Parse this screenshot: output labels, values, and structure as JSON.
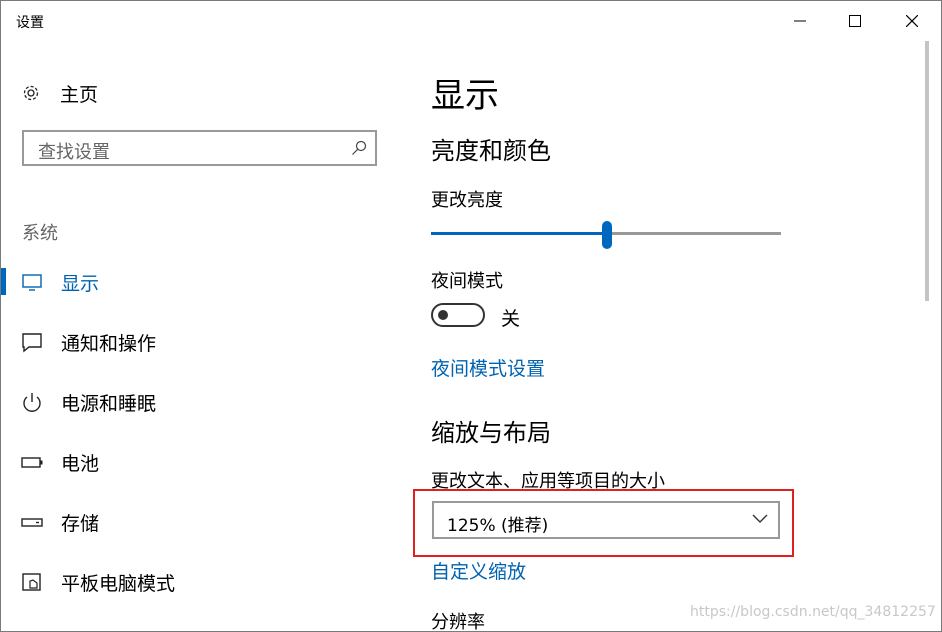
{
  "window": {
    "title": "设置"
  },
  "sidebar": {
    "home_label": "主页",
    "search_placeholder": "查找设置",
    "section_label": "系统",
    "items": [
      {
        "label": "显示",
        "icon": "monitor-icon",
        "active": true
      },
      {
        "label": "通知和操作",
        "icon": "notification-icon",
        "active": false
      },
      {
        "label": "电源和睡眠",
        "icon": "power-icon",
        "active": false
      },
      {
        "label": "电池",
        "icon": "battery-icon",
        "active": false
      },
      {
        "label": "存储",
        "icon": "storage-icon",
        "active": false
      },
      {
        "label": "平板电脑模式",
        "icon": "tablet-mode-icon",
        "active": false
      }
    ]
  },
  "content": {
    "page_title": "显示",
    "brightness_section": "亮度和颜色",
    "brightness_label": "更改亮度",
    "brightness_value": 0.5,
    "night_mode_label": "夜间模式",
    "night_mode_state": "关",
    "night_mode_settings_link": "夜间模式设置",
    "scale_section": "缩放与布局",
    "scale_label": "更改文本、应用等项目的大小",
    "scale_value": "125% (推荐)",
    "custom_scale_link": "自定义缩放",
    "resolution_label": "分辨率"
  },
  "watermark": "https://blog.csdn.net/qq_34812257",
  "colors": {
    "accent": "#0067c0",
    "link": "#0063b1",
    "highlight": "#e02020"
  }
}
